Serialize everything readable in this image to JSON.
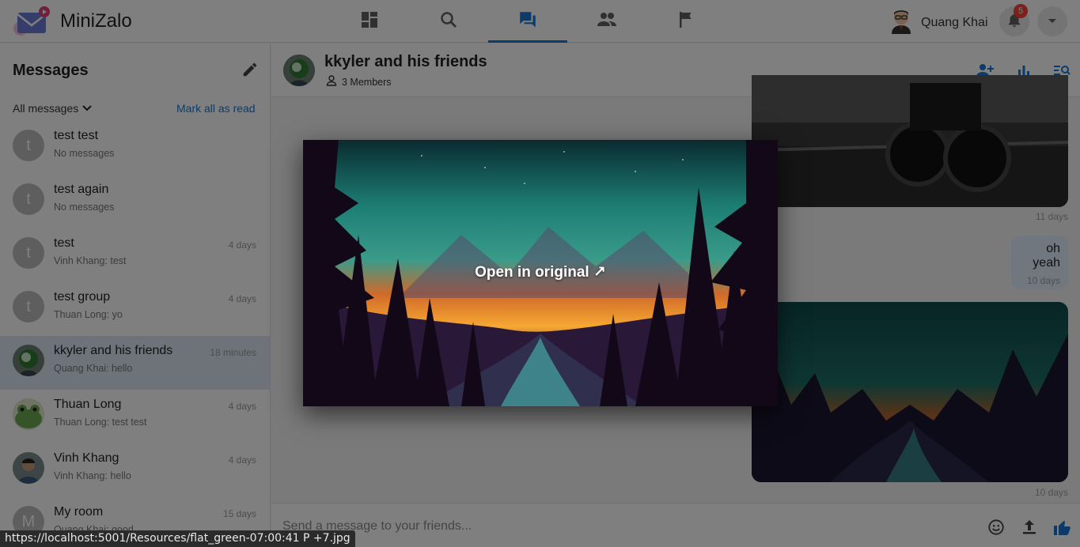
{
  "app": {
    "name": "MiniZalo"
  },
  "nav": [
    {
      "icon": "dashboard-icon",
      "active": false
    },
    {
      "icon": "search-icon",
      "active": false
    },
    {
      "icon": "chat-icon",
      "active": true
    },
    {
      "icon": "people-icon",
      "active": false
    },
    {
      "icon": "flag-icon",
      "active": false
    }
  ],
  "user": {
    "name": "Quang Khai",
    "notifications": "5"
  },
  "sidebar": {
    "title": "Messages",
    "filter": "All messages",
    "mark_all": "Mark all as read",
    "conversations": [
      {
        "name": "test test",
        "last": "No messages",
        "time": "",
        "initial": "t"
      },
      {
        "name": "test again",
        "last": "No messages",
        "time": "",
        "initial": "t"
      },
      {
        "name": "test",
        "last": "Vinh Khang: test",
        "time": "4 days",
        "initial": "t"
      },
      {
        "name": "test group",
        "last": "Thuan Long: yo",
        "time": "4 days",
        "initial": "t"
      },
      {
        "name": "kkyler and his friends",
        "last": "Quang Khai: hello",
        "time": "18 minutes",
        "initial": ""
      },
      {
        "name": "Thuan Long",
        "last": "Thuan Long: test test",
        "time": "4 days",
        "initial": ""
      },
      {
        "name": "Vinh Khang",
        "last": "Vinh Khang: hello",
        "time": "4 days",
        "initial": ""
      },
      {
        "name": "My room",
        "last": "Quang Khai: good",
        "time": "15 days",
        "initial": "M"
      }
    ]
  },
  "chat": {
    "title": "kkyler and his friends",
    "members": "3 Members",
    "messages": [
      {
        "type": "image",
        "time": "11 days"
      },
      {
        "type": "text",
        "text": "oh yeah",
        "time": "10 days"
      },
      {
        "type": "image",
        "time": "10 days"
      }
    ],
    "composer_placeholder": "Send a message to your friends..."
  },
  "lightbox": {
    "label": "Open in original ↗"
  },
  "status_url": "https://localhost:5001/Resources/flat_green-07:00:41 P +7.jpg",
  "colors": {
    "accent": "#1976d2",
    "active_row": "#dbe6f3",
    "badge": "#f44336"
  }
}
